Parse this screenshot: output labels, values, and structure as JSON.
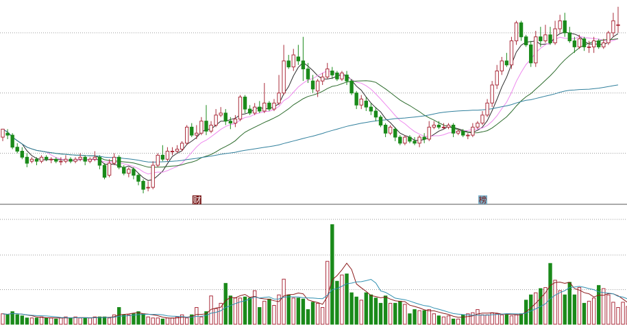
{
  "colors": {
    "up": "#aa2b3a",
    "down": "#1a8a1a",
    "ma5": "#2b2b2b",
    "ma10": "#ee88ee",
    "ma20": "#2a6a2a",
    "ma60": "#2f7f9c",
    "vol_ma5": "#8b1a1a",
    "vol_ma10": "#2f8fb0",
    "grid": "#9a9a9a",
    "divider": "#555555",
    "marker_bg_1": "#7a1b1b",
    "marker_bg_2": "#7ab0c8"
  },
  "markers": [
    {
      "index": 40,
      "label": "财"
    },
    {
      "index": 99,
      "label": "榜"
    }
  ],
  "chart_data": [
    {
      "type": "candlestick",
      "title": "",
      "ylim": [
        8.0,
        17.5
      ],
      "grid_levels": [
        16.0,
        13.0,
        10.0
      ],
      "series": [
        {
          "name": "",
          "role": "ma5",
          "window": 5
        },
        {
          "name": "",
          "role": "ma10",
          "window": 10
        },
        {
          "name": "",
          "role": "ma20",
          "window": 20
        },
        {
          "name": "",
          "role": "ma60",
          "window": 60
        }
      ],
      "candles": [
        [
          10.8,
          11.2,
          11.2,
          10.6
        ],
        [
          11.0,
          10.9,
          11.2,
          10.7
        ],
        [
          10.9,
          10.3,
          11.0,
          10.2
        ],
        [
          10.3,
          10.1,
          10.5,
          10.0
        ],
        [
          10.1,
          9.8,
          10.3,
          9.7
        ],
        [
          9.8,
          9.5,
          10.0,
          9.3
        ],
        [
          9.6,
          9.7,
          9.8,
          9.5
        ],
        [
          9.7,
          9.6,
          9.8,
          9.4
        ],
        [
          9.6,
          9.8,
          9.9,
          9.5
        ],
        [
          9.8,
          9.7,
          9.9,
          9.6
        ],
        [
          9.7,
          9.7,
          9.8,
          9.5
        ],
        [
          9.7,
          9.6,
          9.8,
          9.5
        ],
        [
          9.6,
          9.6,
          9.8,
          9.4
        ],
        [
          9.6,
          9.7,
          9.9,
          9.5
        ],
        [
          9.7,
          9.6,
          9.8,
          9.5
        ],
        [
          9.6,
          9.7,
          9.8,
          9.5
        ],
        [
          9.7,
          9.8,
          10.0,
          9.6
        ],
        [
          9.8,
          9.6,
          9.9,
          9.4
        ],
        [
          9.6,
          9.7,
          9.8,
          9.5
        ],
        [
          9.7,
          9.8,
          10.1,
          9.6
        ],
        [
          9.8,
          9.4,
          9.9,
          9.2
        ],
        [
          9.4,
          8.8,
          9.5,
          8.7
        ],
        [
          8.9,
          9.5,
          9.7,
          8.8
        ],
        [
          9.5,
          9.8,
          10.0,
          9.4
        ],
        [
          9.8,
          9.3,
          9.9,
          9.2
        ],
        [
          9.3,
          9.0,
          9.4,
          8.9
        ],
        [
          9.0,
          9.2,
          9.3,
          8.8
        ],
        [
          9.2,
          8.9,
          9.3,
          8.7
        ],
        [
          8.9,
          8.6,
          9.0,
          8.4
        ],
        [
          8.6,
          8.2,
          8.7,
          8.0
        ],
        [
          8.3,
          8.3,
          8.6,
          8.1
        ],
        [
          8.3,
          9.4,
          9.6,
          8.2
        ],
        [
          9.4,
          9.9,
          10.0,
          9.3
        ],
        [
          9.9,
          9.7,
          10.4,
          9.6
        ],
        [
          9.7,
          10.1,
          10.3,
          9.6
        ],
        [
          10.1,
          10.1,
          10.3,
          9.9
        ],
        [
          10.1,
          10.2,
          10.4,
          10.0
        ],
        [
          10.2,
          10.5,
          10.6,
          10.1
        ],
        [
          10.5,
          11.3,
          11.4,
          10.4
        ],
        [
          11.3,
          10.9,
          11.5,
          10.8
        ],
        [
          10.9,
          11.0,
          11.4,
          10.7
        ],
        [
          11.0,
          11.6,
          11.8,
          10.9
        ],
        [
          11.6,
          11.1,
          12.4,
          10.9
        ],
        [
          11.1,
          11.4,
          11.6,
          11.0
        ],
        [
          11.4,
          11.9,
          12.2,
          11.3
        ],
        [
          11.9,
          12.0,
          12.3,
          11.8
        ],
        [
          12.0,
          11.6,
          12.2,
          11.4
        ],
        [
          11.6,
          11.5,
          11.8,
          11.2
        ],
        [
          11.5,
          11.7,
          11.9,
          11.3
        ],
        [
          11.7,
          12.8,
          12.9,
          11.6
        ],
        [
          12.8,
          12.2,
          12.9,
          12.0
        ],
        [
          12.2,
          12.0,
          12.4,
          11.9
        ],
        [
          12.0,
          12.3,
          12.5,
          11.9
        ],
        [
          12.3,
          12.1,
          12.6,
          12.0
        ],
        [
          12.1,
          12.5,
          13.5,
          12.0
        ],
        [
          12.5,
          12.2,
          12.6,
          12.1
        ],
        [
          12.2,
          12.5,
          12.7,
          12.1
        ],
        [
          12.5,
          13.0,
          13.9,
          12.4
        ],
        [
          13.0,
          14.6,
          15.4,
          12.9
        ],
        [
          14.6,
          14.3,
          14.9,
          14.2
        ],
        [
          14.3,
          14.9,
          15.2,
          14.1
        ],
        [
          14.8,
          14.6,
          15.4,
          14.4
        ],
        [
          14.6,
          14.2,
          15.8,
          13.6
        ],
        [
          14.2,
          13.7,
          14.5,
          13.5
        ],
        [
          13.6,
          13.2,
          13.9,
          13.0
        ],
        [
          13.1,
          13.6,
          13.7,
          12.8
        ],
        [
          13.6,
          13.8,
          14.0,
          13.4
        ],
        [
          13.8,
          14.2,
          14.5,
          13.7
        ],
        [
          14.1,
          13.9,
          14.3,
          13.7
        ],
        [
          14.0,
          13.7,
          14.1,
          13.6
        ],
        [
          13.7,
          14.0,
          14.1,
          13.6
        ],
        [
          13.9,
          13.6,
          14.1,
          13.4
        ],
        [
          13.6,
          13.0,
          13.7,
          12.9
        ],
        [
          13.0,
          12.4,
          13.1,
          12.2
        ],
        [
          12.4,
          12.7,
          12.9,
          12.2
        ],
        [
          12.6,
          12.3,
          12.8,
          12.1
        ],
        [
          12.3,
          12.1,
          12.5,
          11.9
        ],
        [
          12.1,
          11.8,
          12.3,
          11.6
        ],
        [
          11.8,
          11.4,
          11.9,
          11.3
        ],
        [
          11.4,
          11.0,
          11.5,
          10.8
        ],
        [
          11.0,
          11.3,
          11.4,
          10.9
        ],
        [
          11.2,
          10.8,
          11.3,
          10.6
        ],
        [
          10.8,
          10.5,
          10.9,
          10.4
        ],
        [
          10.5,
          10.8,
          10.9,
          10.4
        ],
        [
          10.8,
          10.6,
          10.9,
          10.5
        ],
        [
          10.6,
          10.5,
          10.8,
          10.4
        ],
        [
          10.5,
          10.8,
          10.9,
          10.3
        ],
        [
          10.8,
          10.7,
          11.0,
          10.5
        ],
        [
          10.7,
          11.3,
          11.6,
          10.6
        ],
        [
          11.3,
          11.4,
          11.6,
          11.2
        ],
        [
          11.4,
          11.3,
          11.6,
          11.2
        ],
        [
          11.3,
          11.3,
          11.5,
          11.2
        ],
        [
          11.3,
          11.4,
          11.5,
          11.2
        ],
        [
          11.4,
          11.0,
          11.5,
          10.8
        ],
        [
          11.0,
          11.1,
          11.2,
          10.9
        ],
        [
          11.1,
          10.9,
          11.2,
          10.8
        ],
        [
          10.9,
          10.9,
          11.0,
          10.7
        ],
        [
          10.9,
          11.3,
          11.5,
          10.8
        ],
        [
          11.3,
          11.5,
          11.6,
          11.2
        ],
        [
          11.5,
          11.9,
          12.1,
          11.4
        ],
        [
          11.9,
          12.5,
          12.7,
          11.8
        ],
        [
          12.5,
          13.4,
          13.6,
          12.3
        ],
        [
          13.4,
          14.1,
          14.4,
          13.2
        ],
        [
          14.1,
          14.6,
          14.8,
          13.9
        ],
        [
          14.6,
          14.4,
          15.0,
          14.3
        ],
        [
          14.4,
          15.6,
          15.8,
          14.2
        ],
        [
          15.6,
          16.5,
          16.6,
          15.4
        ],
        [
          16.5,
          15.8,
          16.6,
          15.6
        ],
        [
          15.8,
          15.4,
          15.9,
          15.3
        ],
        [
          15.4,
          14.5,
          15.6,
          14.3
        ],
        [
          14.5,
          15.8,
          16.1,
          14.3
        ],
        [
          15.8,
          15.6,
          16.3,
          15.3
        ],
        [
          15.6,
          15.9,
          16.4,
          15.5
        ],
        [
          15.9,
          15.5,
          16.3,
          15.4
        ],
        [
          15.5,
          16.2,
          16.6,
          15.4
        ],
        [
          16.2,
          16.6,
          16.9,
          16.0
        ],
        [
          16.6,
          16.0,
          17.0,
          15.8
        ],
        [
          16.0,
          15.6,
          16.3,
          15.5
        ],
        [
          15.6,
          15.3,
          15.8,
          15.0
        ],
        [
          15.3,
          15.7,
          15.9,
          15.2
        ],
        [
          15.7,
          15.3,
          15.8,
          15.1
        ],
        [
          15.3,
          15.3,
          15.6,
          15.0
        ],
        [
          15.3,
          15.6,
          15.8,
          15.0
        ],
        [
          15.6,
          15.3,
          15.7,
          15.2
        ],
        [
          15.3,
          15.5,
          15.7,
          15.2
        ],
        [
          15.5,
          16.0,
          16.1,
          15.4
        ],
        [
          16.0,
          16.6,
          17.0,
          15.8
        ],
        [
          16.4,
          16.4,
          17.3,
          16.0
        ]
      ]
    },
    {
      "type": "bar",
      "title": "",
      "ylim": [
        0,
        100
      ],
      "grid_levels": [
        100,
        66,
        33
      ],
      "series": [
        {
          "name": "",
          "role": "vol_ma5",
          "window": 5
        },
        {
          "name": "",
          "role": "vol_ma10",
          "window": 10
        }
      ],
      "values": [
        10,
        9,
        12,
        9,
        8,
        6,
        6,
        6,
        7,
        6,
        6,
        5,
        6,
        7,
        6,
        7,
        6,
        6,
        6,
        7,
        7,
        7,
        6,
        9,
        16,
        9,
        9,
        10,
        12,
        10,
        7,
        6,
        6,
        5,
        6,
        6,
        7,
        9,
        6,
        9,
        16,
        7,
        12,
        27,
        15,
        20,
        39,
        27,
        25,
        25,
        26,
        25,
        32,
        16,
        22,
        24,
        18,
        28,
        43,
        28,
        25,
        25,
        24,
        14,
        21,
        20,
        16,
        60,
        95,
        41,
        47,
        48,
        30,
        26,
        23,
        30,
        28,
        25,
        20,
        27,
        20,
        20,
        22,
        19,
        10,
        14,
        13,
        13,
        14,
        10,
        8,
        7,
        8,
        5,
        5,
        9,
        10,
        11,
        14,
        9,
        9,
        11,
        10,
        9,
        9,
        8,
        9,
        10,
        23,
        28,
        30,
        34,
        35,
        58,
        42,
        32,
        28,
        40,
        28,
        35,
        20,
        22,
        25,
        37,
        34,
        28,
        21,
        16,
        21,
        17,
        18,
        28,
        30,
        31,
        33
      ]
    }
  ]
}
